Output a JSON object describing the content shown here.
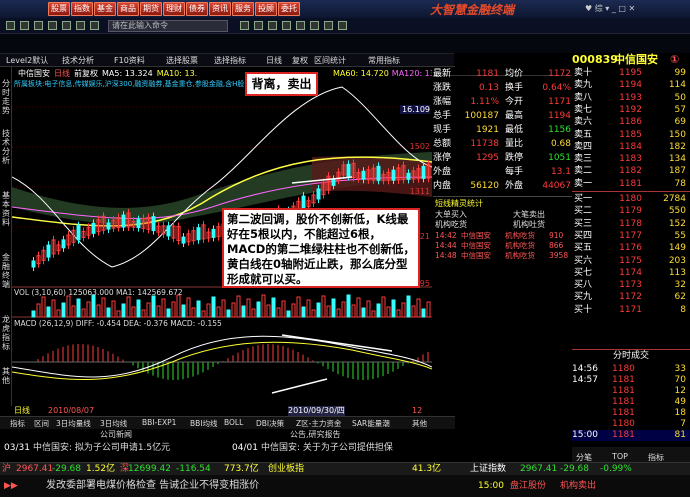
{
  "topbar": {
    "buttons": [
      "股票",
      "指数",
      "基金",
      "商品",
      "期货",
      "理财",
      "债券",
      "资讯",
      "服务",
      "投顾",
      "委托"
    ],
    "brand": "大智慧金融终端",
    "win": "♥ 综 ▾ _ □ ✕"
  },
  "toolbar": {
    "cmd_placeholder": "请在此输入命令"
  },
  "tabs": [
    "Level2默认",
    "技术分析",
    "F10资料",
    "选择股票",
    "选择指标",
    "日线",
    "复权",
    "区间统计",
    "常用指标"
  ],
  "sidebar": [
    "分时走势",
    "技术分析",
    "基本资料",
    "金融终端",
    "龙虎指标",
    "其他"
  ],
  "header": {
    "stock": "中信国安",
    "period": "日线",
    "mode": "前复权",
    "ma5": "MA5: 13.324",
    "ma10": "MA10: 13.",
    "ma60": "MA60: 14.720",
    "ma120": "MA120: 13.3",
    "tags": "所属板块:电子信息,传媒娱乐,沪深300,融资融券,基金重仓,参股金融,含H股,中小板,创投,"
  },
  "price_axis": [
    "16.109",
    "1502",
    "1311",
    "1121",
    "995"
  ],
  "vol_label": "VOL (3,10,60)  125063.000  MA1: 142569.672",
  "macd_label": "MACD (26,12,9)  DIFF: -0.454  DEA: -0.376  MACD: -0.155",
  "dates": {
    "left": "2010/08/07",
    "sel": "2010/09/30/四",
    "right": "12"
  },
  "date_bar": [
    "日线",
    "2010/08/07",
    "2010/09/30(四)",
    "12"
  ],
  "annotations": {
    "top": "背离，卖出",
    "main": "第二波回调，股价不创新低，K线最好在5根以内，不能超过6根，MACD的第二堆绿柱柱也不创新低，黄白线在0轴附近止跌，那么底分型形成就可以买。"
  },
  "info": {
    "rows": [
      {
        "a": "最新",
        "b": "1181",
        "c": "均价",
        "d": "1172"
      },
      {
        "a": "涨跌",
        "b": "0.13",
        "c": "换手",
        "d": "0.64%"
      },
      {
        "a": "涨幅",
        "b": "1.11%",
        "c": "今开",
        "d": "1171"
      },
      {
        "a": "总手",
        "b": "100187",
        "c": "最高",
        "d": "1194"
      },
      {
        "a": "现手",
        "b": "1921",
        "c": "最低",
        "d": "1156"
      },
      {
        "a": "总额",
        "b": "11738",
        "c": "量比",
        "d": "0.68"
      },
      {
        "a": "涨停",
        "b": "1295",
        "c": "跌停",
        "d": "1051"
      },
      {
        "a": "外盘",
        "b": "",
        "c": "每手",
        "d": "13.1"
      },
      {
        "a": "内盘",
        "b": "56120",
        "c": "外盘",
        "d": "44067"
      }
    ]
  },
  "abnormal": {
    "title": "短线精灵统计",
    "tabs": [
      "大单买入",
      "大笔卖出",
      "机构吃货",
      "机构吐货"
    ],
    "rows": [
      {
        "time": "14:42",
        "name": "中信国安",
        "type": "机构吃货",
        "val": "910"
      },
      {
        "time": "14:44",
        "name": "中信国安",
        "type": "机构吃货",
        "val": "866"
      },
      {
        "time": "14:48",
        "name": "中信国安",
        "type": "机构吃货",
        "val": "3958"
      }
    ]
  },
  "quote": {
    "code": "000839",
    "name": "中信国安",
    "icon": "①",
    "sell": [
      {
        "l": "卖十",
        "p": "1195",
        "v": "99"
      },
      {
        "l": "卖九",
        "p": "1194",
        "v": "114"
      },
      {
        "l": "卖八",
        "p": "1193",
        "v": "50"
      },
      {
        "l": "卖七",
        "p": "1192",
        "v": "57"
      },
      {
        "l": "卖六",
        "p": "1186",
        "v": "69"
      },
      {
        "l": "卖五",
        "p": "1185",
        "v": "150"
      },
      {
        "l": "卖四",
        "p": "1184",
        "v": "182"
      },
      {
        "l": "卖三",
        "p": "1183",
        "v": "134"
      },
      {
        "l": "卖二",
        "p": "1182",
        "v": "187"
      },
      {
        "l": "卖一",
        "p": "1181",
        "v": "78"
      }
    ],
    "buy": [
      {
        "l": "买一",
        "p": "1180",
        "v": "2784"
      },
      {
        "l": "买二",
        "p": "1179",
        "v": "550"
      },
      {
        "l": "买三",
        "p": "1178",
        "v": "152"
      },
      {
        "l": "买四",
        "p": "1177",
        "v": "55"
      },
      {
        "l": "买五",
        "p": "1176",
        "v": "149"
      },
      {
        "l": "买六",
        "p": "1175",
        "v": "203"
      },
      {
        "l": "买七",
        "p": "1174",
        "v": "113"
      },
      {
        "l": "买八",
        "p": "1173",
        "v": "32"
      },
      {
        "l": "买九",
        "p": "1172",
        "v": "62"
      },
      {
        "l": "买十",
        "p": "1171",
        "v": "8"
      }
    ],
    "ticks_title": "分时成交",
    "ticks": [
      {
        "t": "14:56",
        "p": "1180",
        "v": "33"
      },
      {
        "t": "14:57",
        "p": "1181",
        "v": "70"
      },
      {
        "t": "",
        "p": "1181",
        "v": "12"
      },
      {
        "t": "",
        "p": "1181",
        "v": "49"
      },
      {
        "t": "",
        "p": "1181",
        "v": "18"
      },
      {
        "t": "",
        "p": "1180",
        "v": "7"
      },
      {
        "t": "15:00",
        "p": "1181",
        "v": "81"
      }
    ],
    "tabs": [
      "分笔",
      "TOP",
      "指标"
    ]
  },
  "bottom_tabs": [
    "指标",
    "区间",
    "3日均量线",
    "3日均线",
    "BBI-EXP1",
    "BBI均线",
    "BOLL",
    "DBI决策",
    "Z区-主力资金",
    "SAR能量潮",
    "其他"
  ],
  "news_tabs": [
    "公司新闻",
    "公告,研究报告"
  ],
  "news": [
    {
      "time": "03/31",
      "text": "中信国安: 拟为子公司申请1.5亿元"
    },
    {
      "time": "04/01",
      "text": "中信国安: 关于为子公司提供担保"
    }
  ],
  "indices": {
    "sh_label": "沪",
    "sh": "2967.41",
    "sh_chg": "-29.68",
    "sh_amt": "1.52亿",
    "sz_label": "深",
    "sz": "12699.42",
    "sz_chg": "-116.54",
    "sz_amt": "773.7亿",
    "cyb": "创业板指",
    "cyb_v": "41.3亿",
    "sh_right": "上证指数",
    "sh_right_v": "2967.41",
    "sh_right_c": "-29.68",
    "sh_right_p": "-0.99%"
  },
  "ticker": {
    "label": "发改委",
    "text": "发改委部署电煤价格检查 告诫企业不得变相涨价",
    "right1": "15:00",
    "right2": "盘江股份",
    "right3": "机构卖出"
  }
}
